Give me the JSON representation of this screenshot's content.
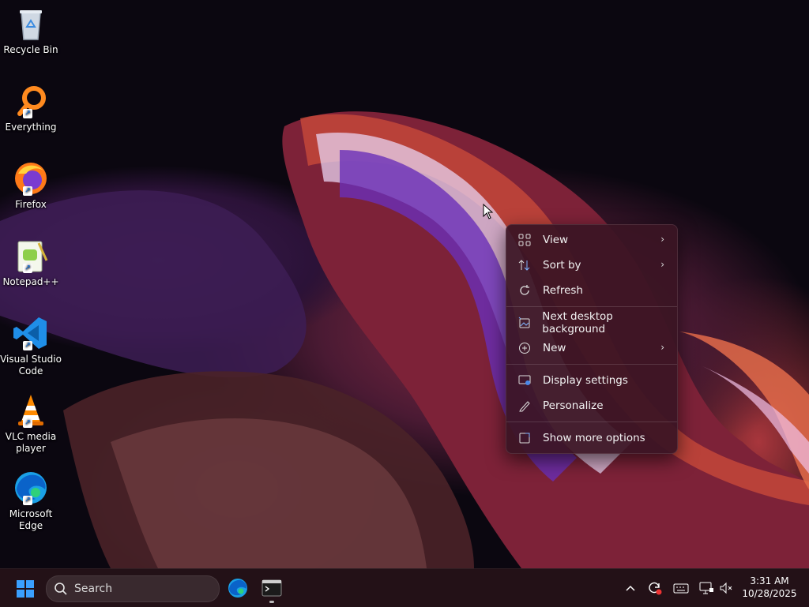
{
  "desktop": {
    "icons": [
      {
        "label": "Recycle Bin",
        "icon": "recycle-bin-icon"
      },
      {
        "label": "Everything",
        "icon": "magnifier-icon"
      },
      {
        "label": "Firefox",
        "icon": "firefox-icon"
      },
      {
        "label": "Notepad++",
        "icon": "notepad-plus-plus-icon"
      },
      {
        "label": "Visual Studio Code",
        "icon": "vscode-icon"
      },
      {
        "label": "VLC media player",
        "icon": "vlc-cone-icon"
      },
      {
        "label": "Microsoft Edge",
        "icon": "edge-icon"
      }
    ]
  },
  "context_menu": {
    "items": [
      {
        "label": "View",
        "icon": "grid-icon",
        "submenu": true
      },
      {
        "label": "Sort by",
        "icon": "sort-arrows-icon",
        "submenu": true
      },
      {
        "label": "Refresh",
        "icon": "refresh-icon",
        "submenu": false
      },
      {
        "label": "Next desktop background",
        "icon": "next-background-icon",
        "submenu": false
      },
      {
        "label": "New",
        "icon": "plus-circle-icon",
        "submenu": true
      },
      {
        "label": "Display settings",
        "icon": "display-icon",
        "submenu": false
      },
      {
        "label": "Personalize",
        "icon": "pencil-icon",
        "submenu": false
      },
      {
        "label": "Show more options",
        "icon": "more-options-icon",
        "submenu": false
      }
    ]
  },
  "taskbar": {
    "search_label": "Search",
    "clock_time": "3:31 AM",
    "clock_date": "10/28/2025"
  },
  "colors": {
    "menu_background": "#3a1424",
    "taskbar_background": "#241218",
    "windows_blue": "#3aa0ff"
  }
}
